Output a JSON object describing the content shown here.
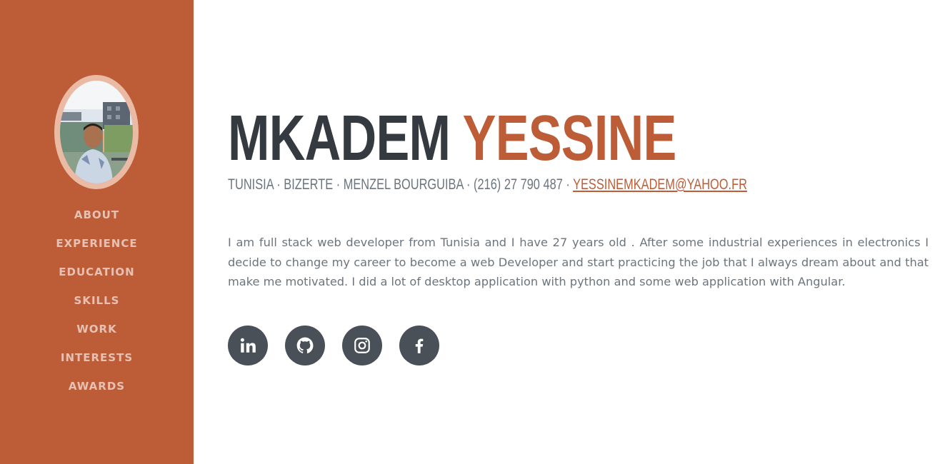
{
  "sidebar": {
    "nav": [
      {
        "label": "About"
      },
      {
        "label": "Experience"
      },
      {
        "label": "Education"
      },
      {
        "label": "Skills"
      },
      {
        "label": "Work"
      },
      {
        "label": "Interests"
      },
      {
        "label": "Awards"
      }
    ]
  },
  "header": {
    "first_name": "Mkadem",
    "last_name": "Yessine"
  },
  "contact": {
    "location": "Tunisia · Bizerte · Menzel Bourguiba · (216) 27 790 487 · ",
    "email": "yessinemkadem@yahoo.fr"
  },
  "about": {
    "text": "I am full stack web developer from Tunisia and I have 27 years old . After some industrial experiences in electronics I decide to change my career to become a web Developer and start practicing the job that I always dream about and that make me motivated. I did a lot of desktop application with python and some web application with Angular."
  },
  "social": {
    "links": [
      {
        "icon": "linkedin-icon"
      },
      {
        "icon": "github-icon"
      },
      {
        "icon": "instagram-icon"
      },
      {
        "icon": "facebook-icon"
      }
    ]
  },
  "colors": {
    "accent": "#bd5d38",
    "heading": "#343a40",
    "text": "#6c757d",
    "icon_bg": "#495057"
  }
}
